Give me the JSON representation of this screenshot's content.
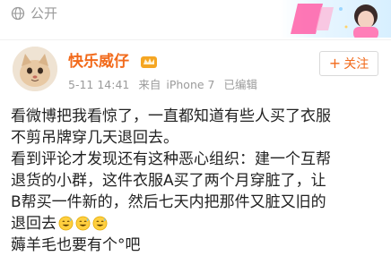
{
  "header": {
    "privacy_label": "公开"
  },
  "user": {
    "name": "快乐威仔",
    "date": "5-11 14:41",
    "source_prefix": "来自",
    "source_device": "iPhone 7",
    "edited": "已编辑"
  },
  "actions": {
    "follow_label": "关注"
  },
  "post": {
    "line1": "看微博把我看惊了，一直都知道有些人买了衣服",
    "line2": "不剪吊牌穿几天退回去。",
    "line3": "看到评论才发现还有这种恶心组织：建一个互帮",
    "line4": "退货的小群，这件衣服A买了两个月穿脏了，让",
    "line5": "B帮买一件新的，然后七天内把那件又脏又旧的",
    "line6": "退回去",
    "line7": "薅羊毛也要有个°吧"
  },
  "colors": {
    "username": "#f26a1b",
    "follow": "#f26a1b",
    "meta": "#9b9b9b",
    "text": "#222222"
  },
  "icons": {
    "privacy": "globe-icon",
    "vip": "vip-crown-icon",
    "emoji": "sweat-smile-emoji"
  }
}
